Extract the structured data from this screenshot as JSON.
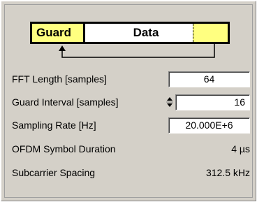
{
  "diagram": {
    "guard_label": "Guard",
    "data_label": "Data"
  },
  "fields": [
    {
      "label": "FFT Length [samples]",
      "value": "64"
    },
    {
      "label": "Guard Interval [samples]",
      "value": "16"
    },
    {
      "label": "Sampling Rate [Hz]",
      "value": "20.000E+6"
    }
  ],
  "readouts": [
    {
      "label": "OFDM Symbol Duration",
      "value": "4 µs"
    },
    {
      "label": "Subcarrier Spacing",
      "value": "312.5 kHz"
    }
  ],
  "colors": {
    "panel": "#d4d0c8",
    "highlight": "#ffff80"
  },
  "icons": {
    "guard_interval_spinner": "up-down-spinner-icon",
    "cyclic_prefix_arrow": "cyclic-prefix-arrow-icon"
  }
}
